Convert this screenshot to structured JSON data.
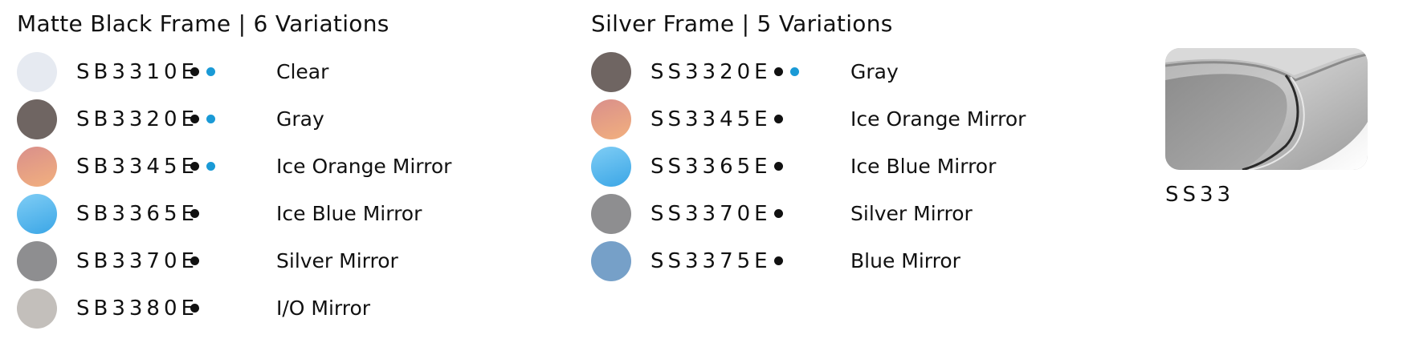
{
  "sections": [
    {
      "title": "Matte Black Frame | 6 Variations",
      "items": [
        {
          "code": "SB3310E",
          "dots": [
            "black",
            "blue"
          ],
          "name": "Clear",
          "swatch": "#e6eaf1"
        },
        {
          "code": "SB3320E",
          "dots": [
            "black",
            "blue"
          ],
          "name": "Gray",
          "swatch": "#6f6562"
        },
        {
          "code": "SB3345E",
          "dots": [
            "black",
            "blue"
          ],
          "name": "Ice Orange Mirror",
          "swatch": "orange-mirror"
        },
        {
          "code": "SB3365E",
          "dots": [
            "black"
          ],
          "name": "Ice Blue Mirror",
          "swatch": "blue-mirror"
        },
        {
          "code": "SB3370E",
          "dots": [
            "black"
          ],
          "name": "Silver Mirror",
          "swatch": "#8e8e90"
        },
        {
          "code": "SB3380E",
          "dots": [
            "black"
          ],
          "name": "I/O Mirror",
          "swatch": "#c3bfbb"
        }
      ]
    },
    {
      "title": "Silver Frame | 5 Variations",
      "items": [
        {
          "code": "SS3320E",
          "dots": [
            "black",
            "blue"
          ],
          "name": "Gray",
          "swatch": "#6f6562"
        },
        {
          "code": "SS3345E",
          "dots": [
            "black"
          ],
          "name": "Ice Orange Mirror",
          "swatch": "orange-mirror"
        },
        {
          "code": "SS3365E",
          "dots": [
            "black"
          ],
          "name": "Ice Blue Mirror",
          "swatch": "blue-mirror"
        },
        {
          "code": "SS3370E",
          "dots": [
            "black"
          ],
          "name": "Silver Mirror",
          "swatch": "#8e8e90"
        },
        {
          "code": "SS3375E",
          "dots": [
            "black"
          ],
          "name": "Blue Mirror",
          "swatch": "#76a0c8"
        }
      ]
    }
  ],
  "product": {
    "code": "SS33",
    "image_icon": "silver-frame-eyewear-detail"
  },
  "colors": {
    "black_dot": "#111111",
    "blue_dot": "#1a9ad6",
    "orange_mirror_top": "#d98f8b",
    "orange_mirror_bottom": "#f2b07e",
    "blue_mirror_top": "#7fcdf5",
    "blue_mirror_bottom": "#3ba6e6"
  }
}
